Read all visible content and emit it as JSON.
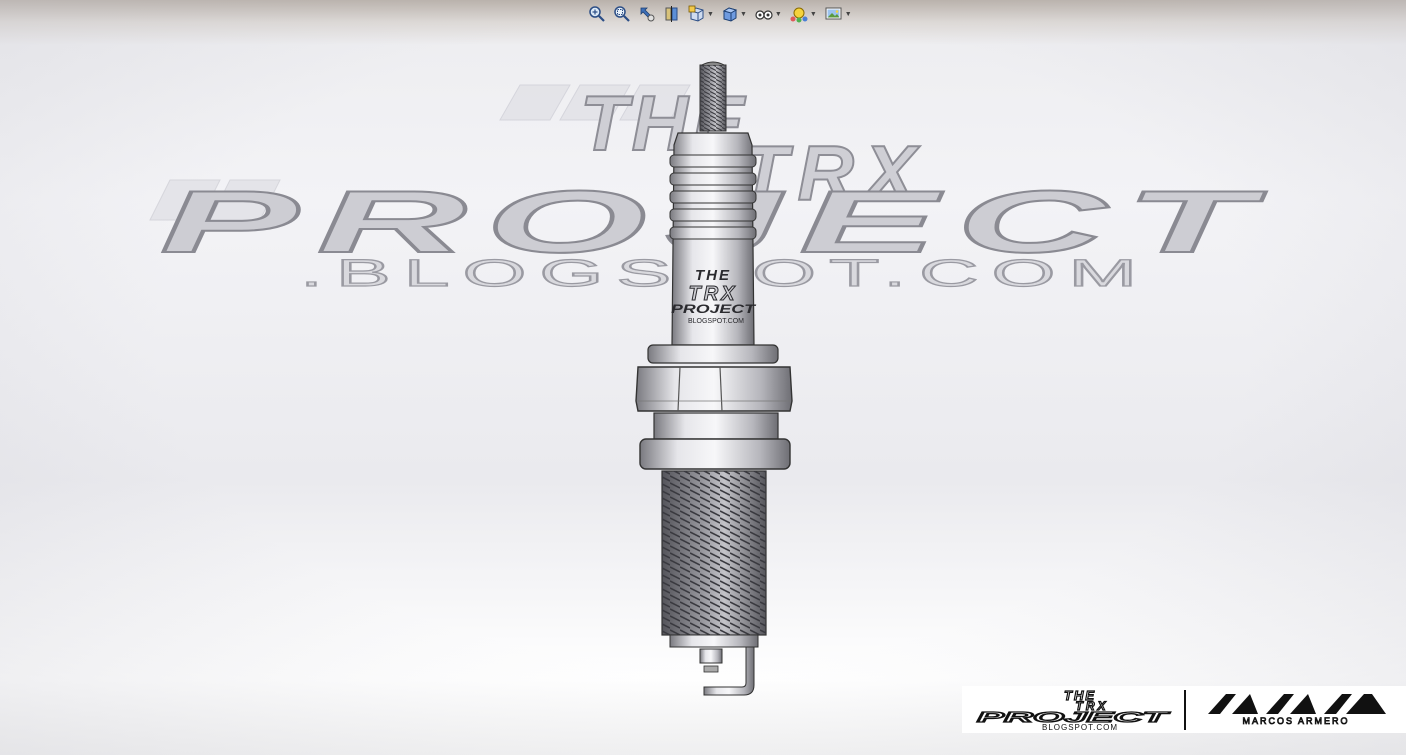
{
  "watermark": {
    "line1": "THE",
    "line2": "TRX",
    "line3": "PROJECT",
    "line4": ".BLOGSPOT.COM"
  },
  "plug_marking": {
    "line1": "THE",
    "line2": "TRX",
    "line3": "PROJECT",
    "line4": "BLOGSPOT.COM"
  },
  "corner_logo": {
    "left_line1": "THE",
    "left_line2": "TRX",
    "left_line3": "PROJECT",
    "left_line4": "BLOGSPOT.COM",
    "right_text": "MARCOS ARMERO"
  },
  "toolbar": {
    "items": [
      {
        "name": "zoom-to-fit",
        "icon": "zoom-fit-icon",
        "dropdown": false
      },
      {
        "name": "zoom-to-area",
        "icon": "zoom-area-icon",
        "dropdown": false
      },
      {
        "name": "previous-view",
        "icon": "previous-view-icon",
        "dropdown": false
      },
      {
        "name": "section-view",
        "icon": "section-view-icon",
        "dropdown": false
      },
      {
        "name": "view-orientation",
        "icon": "view-orientation-icon",
        "dropdown": true
      },
      {
        "name": "display-style",
        "icon": "display-style-icon",
        "dropdown": true
      },
      {
        "name": "hide-show-items",
        "icon": "hide-show-icon",
        "dropdown": true
      },
      {
        "name": "edit-appearance",
        "icon": "appearance-icon",
        "dropdown": true
      },
      {
        "name": "apply-scene",
        "icon": "scene-icon",
        "dropdown": true
      }
    ]
  },
  "colors": {
    "watermark_fill": "#c9c9cf",
    "watermark_stroke": "#8e8e96",
    "metal_light": "#e9e9ec",
    "metal_dark": "#6e6e74",
    "ink": "#111111"
  }
}
